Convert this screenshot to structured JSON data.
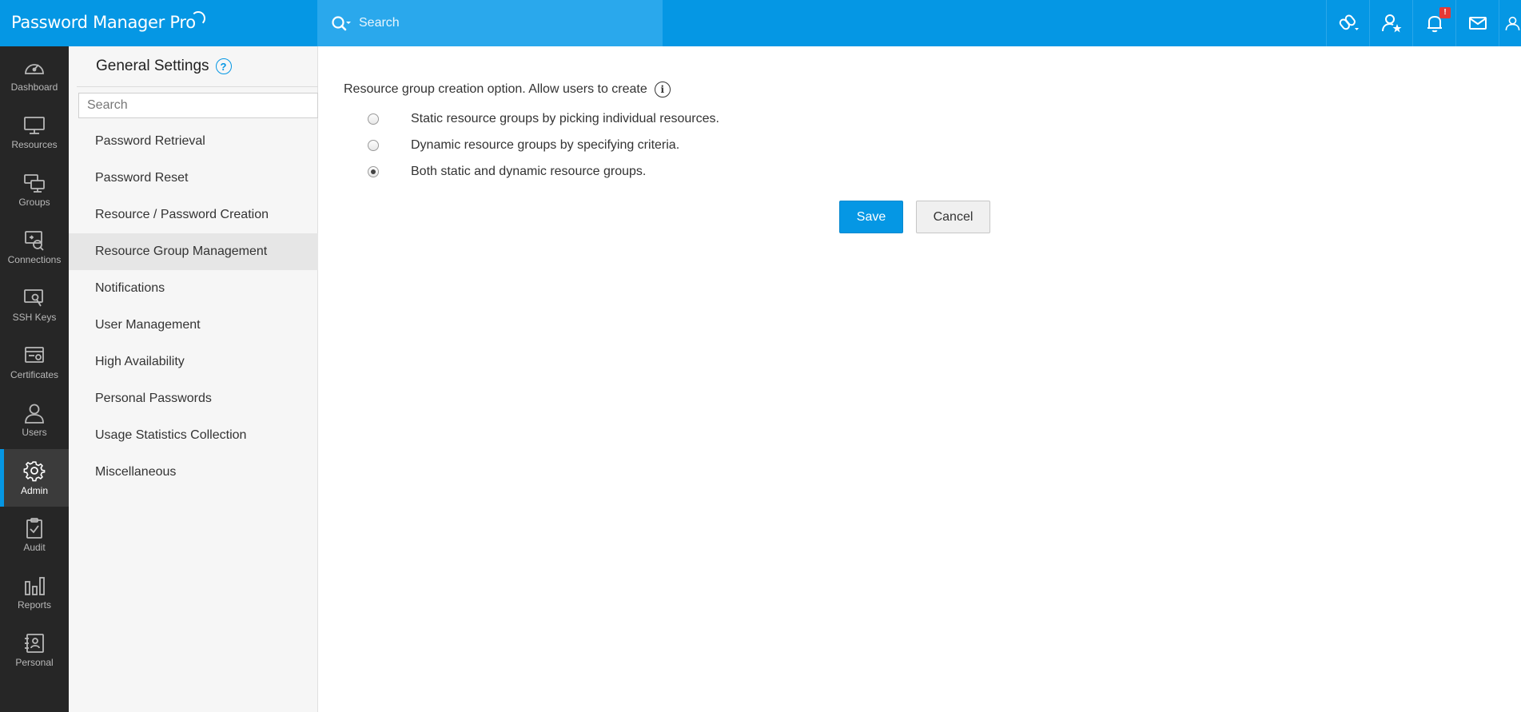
{
  "app": {
    "title": "Password Manager Pro"
  },
  "search": {
    "placeholder": "Search"
  },
  "top_icons": [
    {
      "name": "link-icon"
    },
    {
      "name": "user-star-icon"
    },
    {
      "name": "bell-icon",
      "badge": "!"
    },
    {
      "name": "mail-icon"
    },
    {
      "name": "user-icon"
    }
  ],
  "nav": {
    "items": [
      {
        "label": "Dashboard",
        "icon": "dashboard-icon"
      },
      {
        "label": "Resources",
        "icon": "monitor-icon"
      },
      {
        "label": "Groups",
        "icon": "groups-icon"
      },
      {
        "label": "Connections",
        "icon": "connections-icon"
      },
      {
        "label": "SSH Keys",
        "icon": "ssh-key-icon"
      },
      {
        "label": "Certificates",
        "icon": "certificate-icon"
      },
      {
        "label": "Users",
        "icon": "user-icon"
      },
      {
        "label": "Admin",
        "icon": "gear-icon",
        "active": true
      },
      {
        "label": "Audit",
        "icon": "clipboard-check-icon"
      },
      {
        "label": "Reports",
        "icon": "bar-chart-icon"
      },
      {
        "label": "Personal",
        "icon": "contact-book-icon"
      }
    ]
  },
  "settings": {
    "title": "General Settings",
    "help": "?",
    "search_placeholder": "Search",
    "items": [
      {
        "label": "Password Retrieval"
      },
      {
        "label": "Password Reset"
      },
      {
        "label": "Resource / Password Creation"
      },
      {
        "label": "Resource Group Management",
        "active": true
      },
      {
        "label": "Notifications"
      },
      {
        "label": "User Management"
      },
      {
        "label": "High Availability"
      },
      {
        "label": "Personal Passwords"
      },
      {
        "label": "Usage Statistics Collection"
      },
      {
        "label": "Miscellaneous"
      }
    ]
  },
  "main": {
    "heading": "Resource group creation option. Allow users to create",
    "info": "i",
    "options": [
      {
        "label": "Static resource groups by picking individual resources.",
        "checked": false
      },
      {
        "label": "Dynamic resource groups by specifying criteria.",
        "checked": false
      },
      {
        "label": "Both static and dynamic resource groups.",
        "checked": true
      }
    ],
    "save_label": "Save",
    "cancel_label": "Cancel"
  },
  "colors": {
    "accent": "#0597e4",
    "sidebar_bg": "#262626",
    "badge": "#e53935"
  }
}
